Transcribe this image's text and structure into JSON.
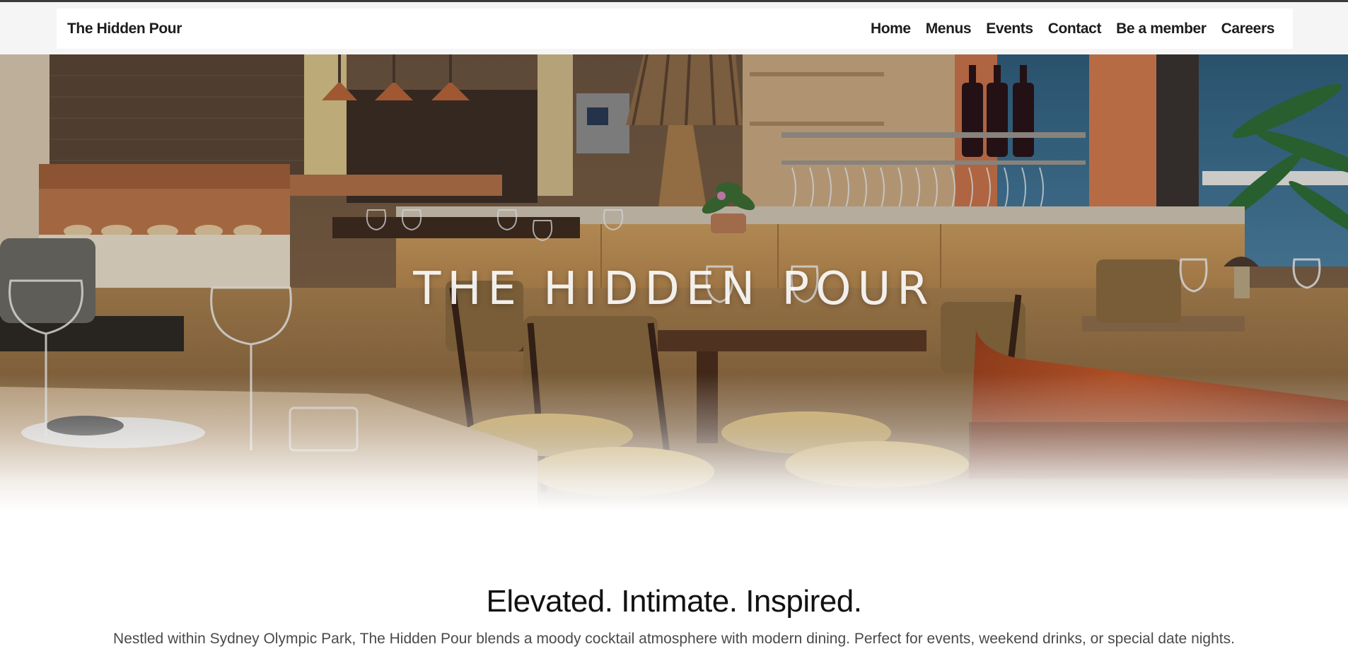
{
  "nav": {
    "brand": "The Hidden Pour",
    "links": [
      "Home",
      "Menus",
      "Events",
      "Contact",
      "Be a member",
      "Careers"
    ]
  },
  "hero": {
    "title": "THE HIDDEN POUR"
  },
  "intro": {
    "heading": "Elevated. Intimate. Inspired.",
    "text": "Nestled within Sydney Olympic Park, The Hidden Pour blends a moody cocktail atmosphere with modern dining. Perfect for events, weekend drinks, or special date nights."
  },
  "colors": {
    "nav_background": "#f5f5f6",
    "nav_text": "#1d1d1f",
    "body_text": "#4a4a4a",
    "heading_text": "#111111"
  }
}
